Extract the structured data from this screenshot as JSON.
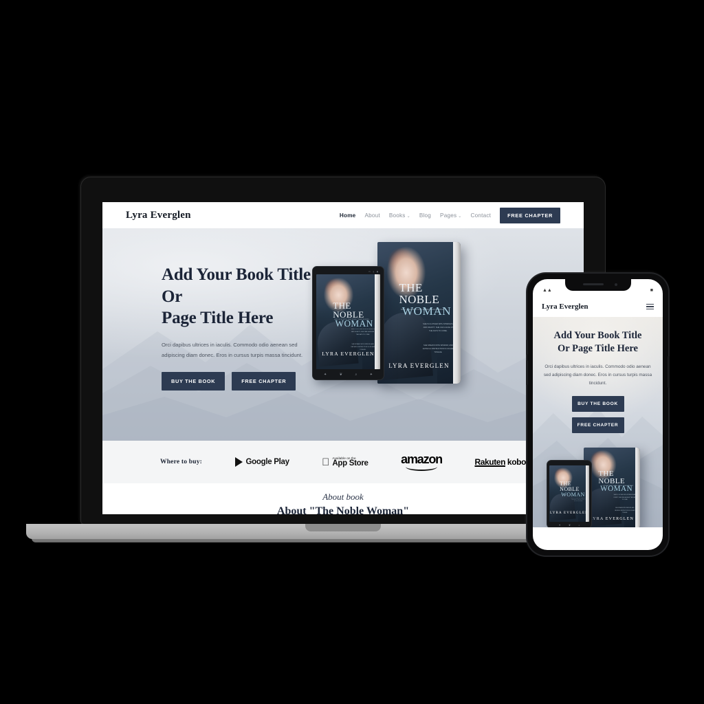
{
  "site": {
    "brand": "Lyra Everglen",
    "nav": [
      {
        "label": "Home",
        "active": true,
        "caret": ""
      },
      {
        "label": "About",
        "active": false,
        "caret": ""
      },
      {
        "label": "Books",
        "active": false,
        "caret": "⌄"
      },
      {
        "label": "Blog",
        "active": false,
        "caret": ""
      },
      {
        "label": "Pages",
        "active": false,
        "caret": "⌄"
      },
      {
        "label": "Contact",
        "active": false,
        "caret": ""
      }
    ],
    "nav_cta": "FREE CHAPTER",
    "hero": {
      "title_line1": "Add Your Book Title Or",
      "title_line2": "Page Title Here",
      "paragraph": "Orci dapibus ultrices in iaculis. Commodo odio aenean sed adipiscing diam donec. Eros in cursus turpis massa tincidunt.",
      "button_primary": "BUY THE BOOK",
      "button_secondary": "FREE CHAPTER"
    },
    "where_to_buy": {
      "label": "Where to buy:",
      "retailers": [
        {
          "name": "google-play",
          "text": "Google Play"
        },
        {
          "name": "app-store",
          "line1": "Available on the",
          "line2": "App Store"
        },
        {
          "name": "amazon",
          "text": "amazon"
        },
        {
          "name": "rakuten-kobo",
          "text1": "Rakuten",
          "text2": " kobo"
        }
      ]
    },
    "about": {
      "script": "About book",
      "heading": "About \"The Noble Woman\""
    }
  },
  "book": {
    "title_line1": "THE NOBLE",
    "title_line2": "WOMAN",
    "tagline": "SHE IS WORTH FAR MORE THAN RUBIES",
    "quote1": "SHE IS CLOTHED WITH STRENGTH AND DIGNITY; SHE CAN LAUGH AT THE DAYS TO COME.",
    "quote2": "SHE SPEAKS WITH WISDOM, AND FAITHFUL INSTRUCTION IS ON HER TONGUE.",
    "author": "LYRA EVERGLEN"
  },
  "phone": {
    "brand": "Lyra Everglen",
    "menu_icon": "hamburger-icon",
    "title_line1": "Add Your Book Title",
    "title_line2": "Or Page Title Here",
    "paragraph": "Orci dapibus ultrices in iaculis. Commodo odio aenean sed adipiscing diam donec. Eros in cursus turpis massa tincidunt.",
    "button_primary": "BUY THE BOOK",
    "button_secondary": "FREE CHAPTER",
    "status_left": "signal-icons",
    "status_right": "battery-icon"
  },
  "colors": {
    "navy": "#2d3b52",
    "text_dark": "#1b2437",
    "hero_bg": "#c6ccd5",
    "band_bg": "#f4f5f6",
    "canvas": "#000000"
  }
}
